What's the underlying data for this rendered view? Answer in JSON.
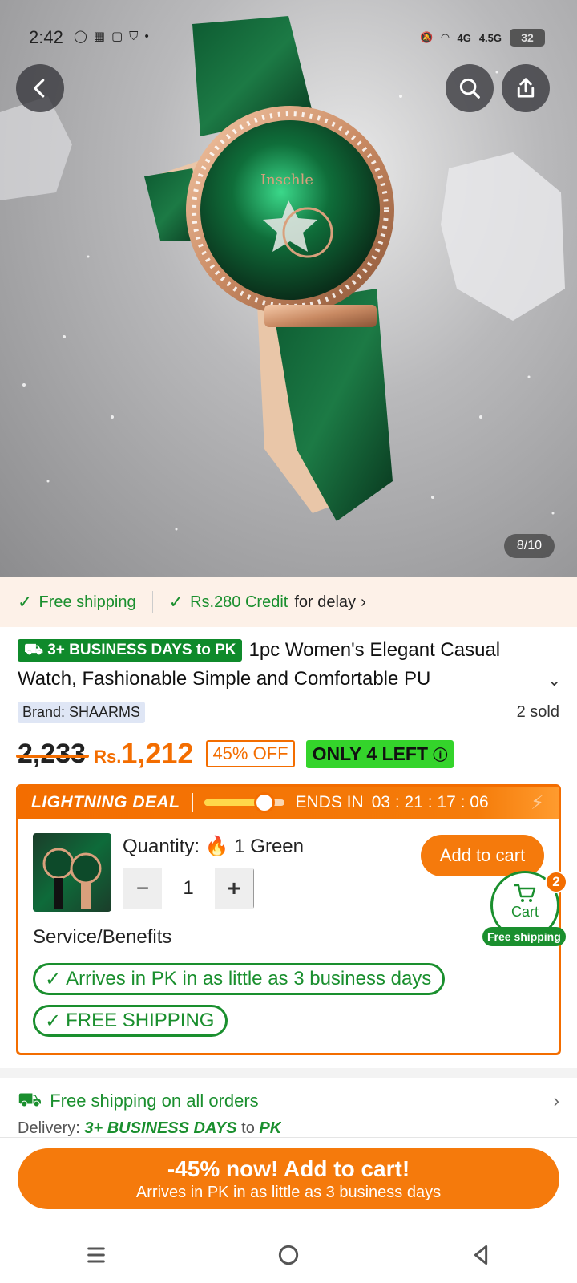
{
  "status_bar": {
    "time": "2:42",
    "network_left": "4G",
    "network_right": "4.5G",
    "battery": "32"
  },
  "hero": {
    "image_counter": "8/10",
    "watch_brand_text": "Inschle"
  },
  "shipping_strip": {
    "free_shipping": "Free shipping",
    "credit": "Rs.280 Credit",
    "credit_suffix": "for delay"
  },
  "product": {
    "business_badge": "3+ BUSINESS DAYS to PK",
    "title": "1pc Women's Elegant Casual Watch, Fashionable Simple and Comfortable PU",
    "brand": "Brand: SHAARMS",
    "sold": "2 sold"
  },
  "price": {
    "old_price": "2,233",
    "currency": "Rs.",
    "new_price": "1,212",
    "discount": "45% OFF",
    "stock": "ONLY 4 LEFT"
  },
  "deal": {
    "title": "LIGHTNING DEAL",
    "ends_label": "ENDS IN",
    "countdown": "03 : 21 : 17 : 06",
    "progress_fraction": 0.75,
    "quantity_label": "Quantity:",
    "quantity_option": "1 Green",
    "quantity_value": "1",
    "add_to_cart": "Add to cart",
    "services_label": "Service/Benefits",
    "benefit_1": "Arrives in PK in as little as 3 business days",
    "benefit_2": "FREE SHIPPING"
  },
  "cart_fab": {
    "label": "Cart",
    "count": "2",
    "shipping": "Free shipping"
  },
  "shipping_info": {
    "free_all": "Free shipping on all orders",
    "delivery_label": "Delivery:",
    "delivery_days": "3+ BUSINESS DAYS",
    "delivery_to": "to",
    "delivery_country": "PK"
  },
  "cta": {
    "main": "-45% now! Add to cart!",
    "sub": "Arrives in PK in as little as 3 business days"
  },
  "colors": {
    "accent": "#f36d00",
    "green": "#1a8f2e"
  }
}
